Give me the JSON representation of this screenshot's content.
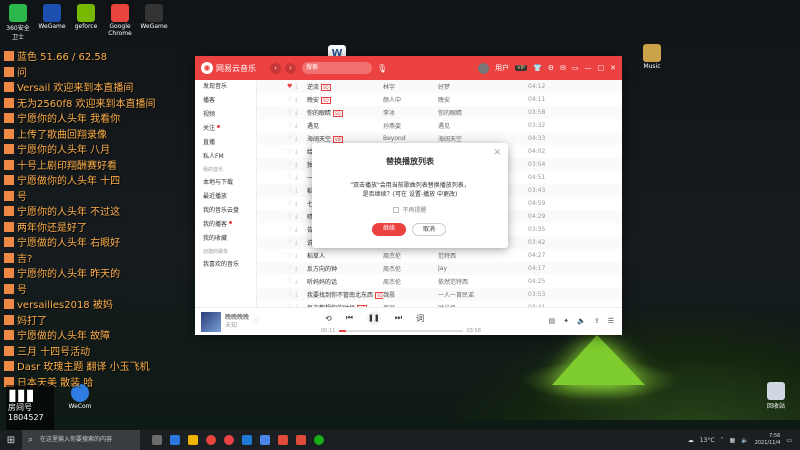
{
  "desktop": {
    "top_icons": [
      {
        "label": "360安全卫士",
        "color": "#2db84b"
      },
      {
        "label": "WeGame",
        "color": "#1d4fb0"
      },
      {
        "label": "geforce",
        "color": "#76b900"
      },
      {
        "label": "Google Chrome",
        "color": "#e8453c"
      },
      {
        "label": "WeGame",
        "color": "#333"
      }
    ],
    "right_icon": {
      "label": "Music",
      "color": "#c9a24a"
    },
    "recycle_bin": {
      "label": "回收站"
    },
    "word_icon": {
      "label": "W"
    },
    "wecom_icon": {
      "label": "WeCom"
    },
    "overlay_messages": [
      "蓝色 51.66 / 62.58",
      "问",
      "Versail 欢迎来到本直播间",
      "无为2560f8 欢迎来到本直播间",
      "宁愿你的人头年 我看你",
      "上传了歌曲回翔录像",
      "宁愿你的人头年 八月",
      "十号上剧印翔酬赛好看",
      "宁愿做你的人头年 十四",
      "号",
      "宁愿你的人头年 不过这",
      "两年你还是好了",
      "宁愿做的人头年 右眼好",
      "吉?",
      "宁愿你的人头年 昨天的",
      "号",
      "versailles2018 被妈",
      "妈打了",
      "宁愿做的人头年 故障",
      "三月 十四号活动",
      "Dasr 玫瑰主题 翻译 小玉飞机",
      "日本天美 散装 哈"
    ],
    "room": {
      "label": "房间号",
      "number": "1804527"
    }
  },
  "app": {
    "brand": "网易云音乐",
    "search_placeholder": "搜索",
    "user": "用户",
    "vip": "VIP",
    "sidebar": [
      {
        "type": "item",
        "label": "发现音乐"
      },
      {
        "type": "item",
        "label": "播客"
      },
      {
        "type": "item",
        "label": "视频"
      },
      {
        "type": "item",
        "label": "关注",
        "dot": true
      },
      {
        "type": "item",
        "label": "直播"
      },
      {
        "type": "item",
        "label": "私人FM"
      },
      {
        "type": "section",
        "label": "我的音乐"
      },
      {
        "type": "item",
        "label": "本地与下载"
      },
      {
        "type": "item",
        "label": "最近播放"
      },
      {
        "type": "item",
        "label": "我的音乐云盘"
      },
      {
        "type": "item",
        "label": "我的播客",
        "dot": true
      },
      {
        "type": "item",
        "label": "我的收藏"
      },
      {
        "type": "section",
        "label": "创建的歌单"
      },
      {
        "type": "item",
        "label": "我喜欢的音乐"
      }
    ],
    "songs": [
      {
        "title": "逆流",
        "tag": "SQ",
        "artist": "林宇",
        "album": "好梦",
        "dur": "04:12",
        "liked": true
      },
      {
        "title": "晚安",
        "tag": "SQ",
        "artist": "颜人中",
        "album": "晚安",
        "dur": "04:11",
        "liked": false
      },
      {
        "title": "你的眼睛",
        "tag": "SQ",
        "artist": "李冰",
        "album": "你的眼睛",
        "dur": "03:58",
        "liked": false
      },
      {
        "title": "遇见",
        "tag": "",
        "artist": "孙燕姿",
        "album": "遇见",
        "dur": "03:32",
        "liked": false
      },
      {
        "title": "海阔天空",
        "tag": "VIP",
        "artist": "Beyond",
        "album": "海阔天空",
        "dur": "04:33",
        "liked": false
      },
      {
        "title": "给我一首歌",
        "tag": "",
        "artist": "周杰伦",
        "album": "周杰伦",
        "dur": "04:02",
        "liked": false
      },
      {
        "title": "独家记忆",
        "tag": "",
        "artist": "陈小春",
        "album": "独家记忆",
        "dur": "03:54",
        "liked": false
      },
      {
        "title": "一路向北",
        "tag": "",
        "artist": "周杰伦",
        "album": "十一月",
        "dur": "04:51",
        "liked": false
      },
      {
        "title": "稻香",
        "tag": "SQ",
        "artist": "周杰伦",
        "album": "魔杰座",
        "dur": "03:43",
        "liked": false
      },
      {
        "title": "七里香",
        "tag": "",
        "artist": "周杰伦",
        "album": "七里香",
        "dur": "04:59",
        "liked": false
      },
      {
        "title": "晴天",
        "tag": "",
        "artist": "周杰伦",
        "album": "叶惠美",
        "dur": "04:29",
        "liked": false
      },
      {
        "title": "告白气球",
        "tag": "",
        "artist": "周杰伦",
        "album": "周杰伦",
        "dur": "03:35",
        "liked": false
      },
      {
        "title": "说好不哭",
        "tag": "",
        "artist": "周杰伦",
        "album": "说好不哭",
        "dur": "03:42",
        "liked": false
      },
      {
        "title": "稻草人",
        "tag": "",
        "artist": "周杰伦",
        "album": "范特西",
        "dur": "04:27",
        "liked": false
      },
      {
        "title": "反方向的钟",
        "tag": "",
        "artist": "周杰伦",
        "album": "Jay",
        "dur": "04:17",
        "liked": false
      },
      {
        "title": "听妈妈的话",
        "tag": "",
        "artist": "周杰伦",
        "album": "依然范特西",
        "dur": "04:25",
        "liked": false
      },
      {
        "title": "我要找到你不管南北东西",
        "tag": "SQ",
        "artist": "魏晨",
        "album": "一人一首民谣",
        "dur": "03:53",
        "liked": false
      },
      {
        "title": "每次都想你的时候",
        "tag": "VIP",
        "artist": "周深",
        "album": "时光机",
        "dur": "03:41",
        "liked": false
      },
      {
        "title": "不喜欢的人都不要来了",
        "tag": "SQ",
        "artist": "周杰伦",
        "album": "十一月的萧邦",
        "dur": "04:35",
        "liked": false
      },
      {
        "title": "有没有一首歌让你想起我",
        "tag": "SQ",
        "artist": "杨坤",
        "album": "有没有",
        "dur": "04:12",
        "liked": false
      }
    ],
    "player": {
      "title": "晚晚晚晚",
      "artist": "未知",
      "time_current": "00:11",
      "time_total": "03:58",
      "progress": 0.05
    }
  },
  "modal": {
    "title": "替换播放列表",
    "message_line1": "\"双击播放\"会用当前歌曲列表替换播放列表，",
    "message_line2": "是否继续？(可在 设置-播放 中更改)",
    "checkbox_label": "不再提醒",
    "confirm": "继续",
    "cancel": "取消"
  },
  "taskbar": {
    "search_placeholder": "在这里输入你要搜索的内容",
    "weather": "13°C",
    "time": "7:56",
    "date": "2021/11/4"
  }
}
